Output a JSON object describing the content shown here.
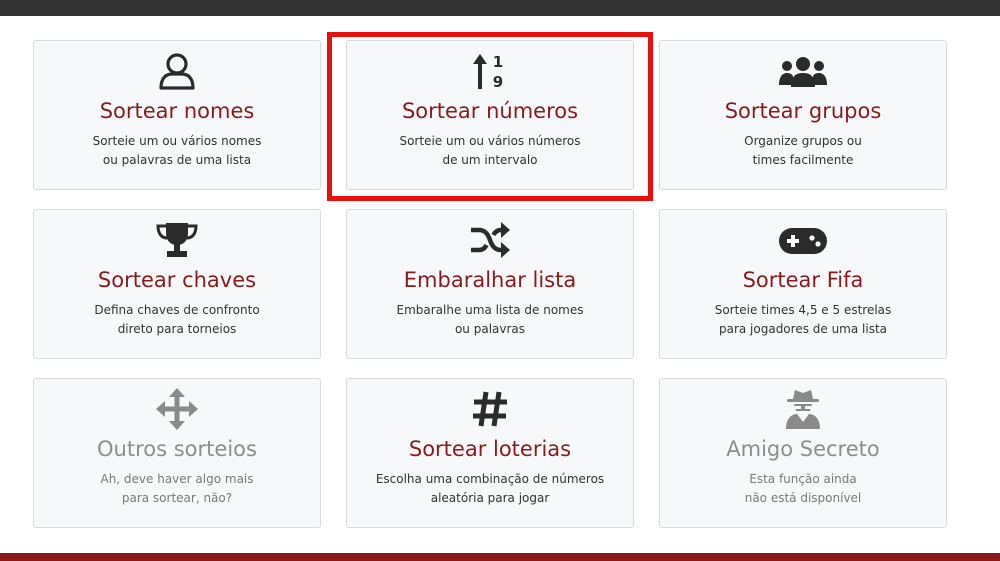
{
  "colors": {
    "title_active": "#8b1a1a",
    "title_disabled": "#8e8e8e",
    "icon_active": "#2b2b2b",
    "icon_disabled": "#8a8a8a",
    "highlight": "#e8100f",
    "topbar": "#343434",
    "bottombar": "#8a1a1a"
  },
  "cards": [
    {
      "icon": "user-icon",
      "title": "Sortear nomes",
      "desc_line1": "Sorteie um ou vários nomes",
      "desc_line2": "ou palavras de uma lista"
    },
    {
      "icon": "sort-numeric-icon",
      "title": "Sortear números",
      "desc_line1": "Sorteie um ou vários números",
      "desc_line2": "de um intervalo"
    },
    {
      "icon": "users-group-icon",
      "title": "Sortear grupos",
      "desc_line1": "Organize grupos ou",
      "desc_line2": "times facilmente"
    },
    {
      "icon": "trophy-icon",
      "title": "Sortear chaves",
      "desc_line1": "Defina chaves de confronto",
      "desc_line2": "direto para torneios"
    },
    {
      "icon": "shuffle-icon",
      "title": "Embaralhar lista",
      "desc_line1": "Embaralhe uma lista de nomes",
      "desc_line2": "ou palavras"
    },
    {
      "icon": "gamepad-icon",
      "title": "Sortear Fifa",
      "desc_line1": "Sorteie times 4,5 e 5 estrelas",
      "desc_line2": "para jogadores de uma lista"
    },
    {
      "icon": "arrows-move-icon",
      "title": "Outros sorteios",
      "desc_line1": "Ah, deve haver algo mais",
      "desc_line2": "para sortear, não?"
    },
    {
      "icon": "hashtag-icon",
      "title": "Sortear loterias",
      "desc_line1": "Escolha uma combinação de números",
      "desc_line2": "aleatória para jogar"
    },
    {
      "icon": "user-secret-icon",
      "title": "Amigo Secreto",
      "desc_line1": "Esta função ainda",
      "desc_line2": "não está disponível"
    }
  ]
}
